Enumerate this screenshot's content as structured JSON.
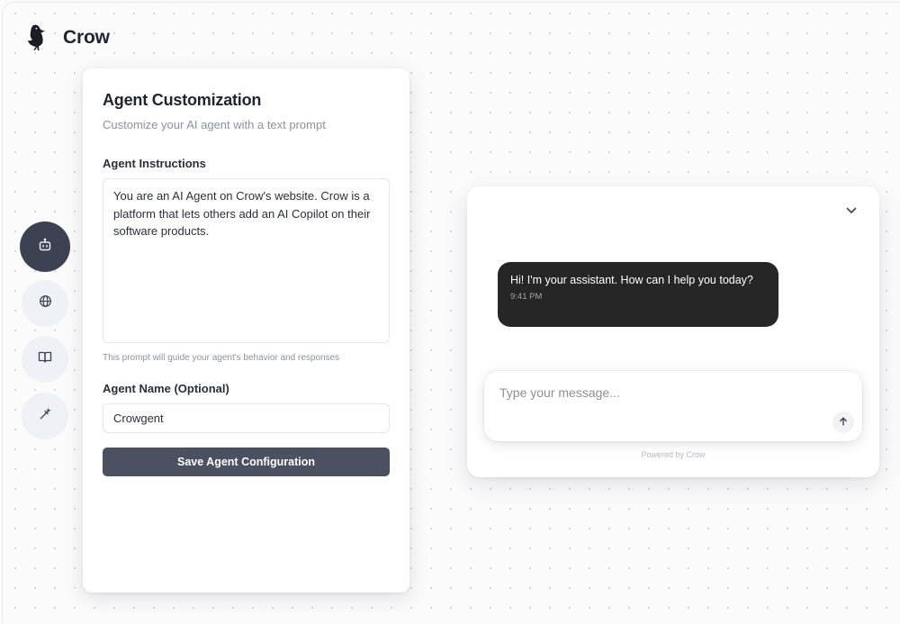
{
  "app": {
    "name": "Crow",
    "logo_icon": "crow-logo-icon"
  },
  "rail": {
    "items": [
      {
        "icon": "bot-icon",
        "active": true
      },
      {
        "icon": "globe-icon",
        "active": false
      },
      {
        "icon": "book-icon",
        "active": false
      },
      {
        "icon": "wand-icon",
        "active": false
      }
    ]
  },
  "customization": {
    "title": "Agent Customization",
    "subtitle": "Customize your AI agent with a text prompt",
    "instructions_label": "Agent Instructions",
    "instructions_value": "You are an AI Agent on Crow's website. Crow is a platform that lets others add an AI Copilot on their software products.",
    "instructions_hint": "This prompt will guide your agent's behavior and responses",
    "name_label": "Agent Name (Optional)",
    "name_value": "Crowgent",
    "save_label": "Save Agent Configuration"
  },
  "chat": {
    "collapse_icon": "chevron-down-icon",
    "messages": [
      {
        "text": "Hi! I'm your assistant. How can I help you today?",
        "time": "9:41 PM"
      }
    ],
    "input_placeholder": "Type your message...",
    "send_icon": "arrow-up-icon",
    "powered_by": "Powered by Crow"
  },
  "colors": {
    "accent_dark": "#3c4252",
    "button": "#4b5161",
    "bubble": "#262626"
  }
}
